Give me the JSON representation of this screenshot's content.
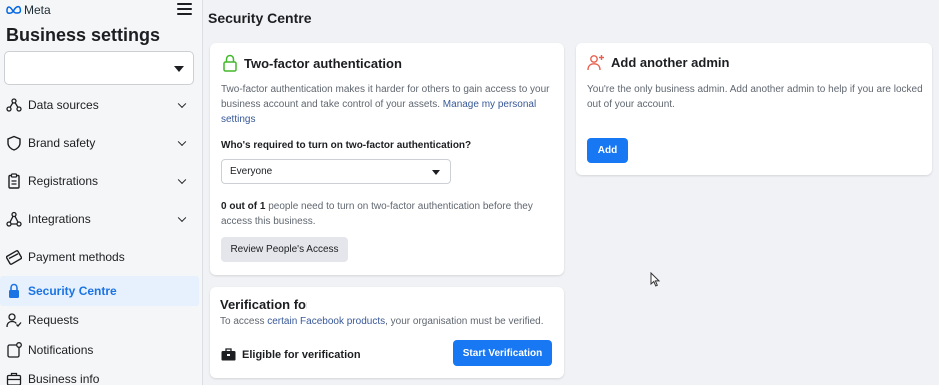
{
  "sidebar": {
    "brand": "Meta",
    "title": "Business settings",
    "account_select_value": "",
    "items": [
      {
        "label": "Data sources",
        "icon": "data-sources-icon",
        "has_chevron": true
      },
      {
        "label": "Brand safety",
        "icon": "shield-icon",
        "has_chevron": true
      },
      {
        "label": "Registrations",
        "icon": "clipboard-icon",
        "has_chevron": true
      },
      {
        "label": "Integrations",
        "icon": "integrations-icon",
        "has_chevron": true
      },
      {
        "label": "Payment methods",
        "icon": "payment-card-icon",
        "has_chevron": false
      },
      {
        "label": "Security Centre",
        "icon": "lock-icon",
        "has_chevron": false,
        "active": true
      },
      {
        "label": "Requests",
        "icon": "person-check-icon",
        "has_chevron": false
      },
      {
        "label": "Notifications",
        "icon": "notification-icon",
        "has_chevron": false
      },
      {
        "label": "Business info",
        "icon": "briefcase-icon",
        "has_chevron": false
      }
    ]
  },
  "main": {
    "title": "Security Centre",
    "two_factor": {
      "icon": "lock-outline-icon",
      "title": "Two-factor authentication",
      "description": "Two-factor authentication makes it harder for others to gain access to your business account and take control of your assets.",
      "link": "Manage my personal settings",
      "question": "Who's required to turn on two-factor authentication?",
      "selected_option": "Everyone",
      "status_bold": "0 out of 1",
      "status_rest": "people need to turn on two-factor authentication before they access this business.",
      "review_button": "Review People's Access"
    },
    "add_admin": {
      "icon": "add-person-icon",
      "title": "Add another admin",
      "description": "You're the only business admin. Add another admin to help if you are locked out of your account.",
      "button": "Add"
    },
    "verification": {
      "title": "Verification for",
      "text_before": "To access",
      "link": "certain Facebook products",
      "text_after": ", your organisation must be verified.",
      "eligible_icon": "briefcase-icon",
      "eligible_label": "Eligible for verification",
      "button": "Start Verification"
    }
  },
  "colors": {
    "accent": "#1877f2",
    "active_nav_text": "#1b74e4",
    "active_nav_bg": "#e7f0fd",
    "link": "#385898",
    "admin_icon": "#e9604f",
    "lock_icon": "#42b72a"
  }
}
